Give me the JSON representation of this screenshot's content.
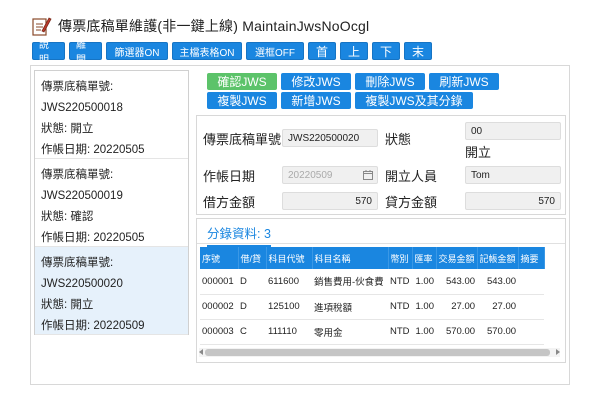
{
  "window": {
    "title": "傳票底稿單維護(非一鍵上線) MaintainJwsNoOcgl"
  },
  "toolbar": {
    "buttons": [
      "說明",
      "離開",
      "篩選器ON",
      "主檔表格ON",
      "選框OFF"
    ],
    "nav": [
      "首",
      "上",
      "下",
      "末"
    ]
  },
  "records": [
    {
      "no_label": "傳票底稿單號:",
      "no": "JWS220500018",
      "status": "狀態: 開立",
      "date": "作帳日期: 20220505"
    },
    {
      "no_label": "傳票底稿單號:",
      "no": "JWS220500019",
      "status": "狀態: 確認",
      "date": "作帳日期: 20220505"
    },
    {
      "no_label": "傳票底稿單號:",
      "no": "JWS220500020",
      "status": "狀態: 開立",
      "date": "作帳日期: 20220509"
    }
  ],
  "actions": {
    "row1": [
      "確認JWS",
      "修改JWS",
      "刪除JWS",
      "刷新JWS"
    ],
    "row2": [
      "複製JWS",
      "新增JWS",
      "複製JWS及其分錄"
    ]
  },
  "form": {
    "no_label": "傳票底稿單號",
    "no_value": "JWS220500020",
    "status_label": "狀態",
    "status_code": "00",
    "status_text": "開立",
    "date_label": "作帳日期",
    "date_value": "20220509",
    "creator_label": "開立人員",
    "creator_value": "Tom",
    "debit_label": "借方金額",
    "debit_value": "570",
    "credit_label": "貸方金額",
    "credit_value": "570"
  },
  "detail": {
    "tab_label": "分錄資料: 3",
    "columns": [
      "序號",
      "借/貸",
      "科目代號",
      "科目名稱",
      "幣別",
      "匯率",
      "交易金額",
      "記帳金額",
      "摘要"
    ],
    "rows": [
      [
        "000001",
        "D",
        "611600",
        "銷售費用-伙食費",
        "NTD",
        "1.00",
        "543.00",
        "543.00",
        ""
      ],
      [
        "000002",
        "D",
        "125100",
        "進項稅額",
        "NTD",
        "1.00",
        "27.00",
        "27.00",
        ""
      ],
      [
        "000003",
        "C",
        "111110",
        "零用金",
        "NTD",
        "1.00",
        "570.00",
        "570.00",
        ""
      ]
    ]
  },
  "colors": {
    "accent": "#1a86e0",
    "confirm": "#5cc36a",
    "selected_row": "#e6f1fb"
  }
}
